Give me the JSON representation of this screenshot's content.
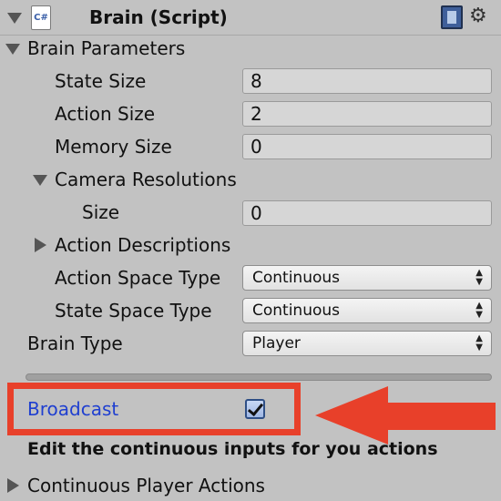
{
  "header": {
    "title": "Brain (Script)",
    "script_icon_text": "C#",
    "icons": [
      "script-file-icon",
      "reference-book-icon",
      "gear-icon"
    ]
  },
  "brain_parameters": {
    "label": "Brain Parameters",
    "state_size": {
      "label": "State Size",
      "value": "8"
    },
    "action_size": {
      "label": "Action Size",
      "value": "2"
    },
    "memory_size": {
      "label": "Memory Size",
      "value": "0"
    },
    "camera_resolutions": {
      "label": "Camera Resolutions",
      "size": {
        "label": "Size",
        "value": "0"
      }
    },
    "action_descriptions": {
      "label": "Action Descriptions"
    },
    "action_space_type": {
      "label": "Action Space Type",
      "value": "Continuous"
    },
    "state_space_type": {
      "label": "State Space Type",
      "value": "Continuous"
    }
  },
  "brain_type": {
    "label": "Brain Type",
    "value": "Player"
  },
  "broadcast": {
    "label": "Broadcast",
    "checked": true
  },
  "help_text": "Edit the continuous inputs for you actions",
  "continuous_player_actions": {
    "label": "Continuous Player Actions"
  },
  "colors": {
    "panel_bg": "#c2c2c2",
    "broadcast_label": "#1f3fd0",
    "annotation_red": "#e8402a"
  }
}
